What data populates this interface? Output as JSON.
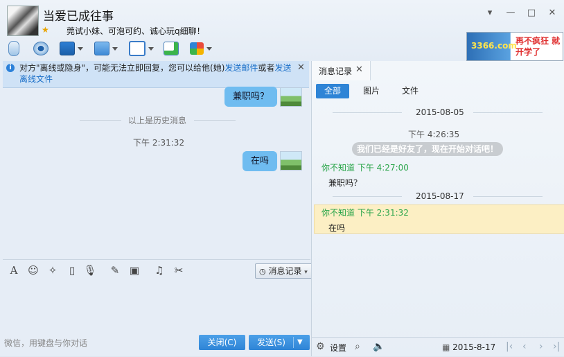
{
  "window": {
    "title": "当爱已成往事",
    "signature": "莞试小妹、可泡可约、诚心玩q细聊！",
    "controls": {
      "dropdown": "▾",
      "minimize": "—",
      "maximize": "□",
      "close": "✕"
    }
  },
  "ad": {
    "logo": "3366.com",
    "slogan": "再不疯狂 就开学了"
  },
  "notice": {
    "prefix": "对方\"离线或隐身\"，可能无法立即回复，您可以给他(她)",
    "link1": "发送邮件",
    "middle": "或者",
    "link2": "发送离线文件"
  },
  "chat": {
    "messages": [
      {
        "text": "兼职吗？"
      },
      {
        "text": "在吗"
      }
    ],
    "history_separator": "以上是历史消息",
    "time": "下午 2:31:32"
  },
  "input": {
    "message_log_label": "消息记录",
    "hint": "微信，用键盘与你对话",
    "close_label": "关闭(C)",
    "send_label": "发送(S)"
  },
  "history_panel": {
    "tab_label": "消息记录",
    "filters": [
      "全部",
      "图片",
      "文件"
    ],
    "date1": "2015-08-05",
    "time1": "下午 4:26:35",
    "friend_notice": "我们已经是好友了，现在开始对话吧！",
    "entry1_sender": "你不知道 下午 4:27:00",
    "entry1_text": "兼职吗？",
    "date2": "2015-08-17",
    "entry2_sender": "你不知道 下午 2:31:32",
    "entry2_text": "在吗",
    "settings_label": "设置",
    "current_date": "2015-8-17"
  },
  "colors": {
    "accent": "#2e84d6",
    "bubble": "#6fbcf0",
    "sender": "#2aa54a",
    "highlight": "#fcefc4"
  }
}
